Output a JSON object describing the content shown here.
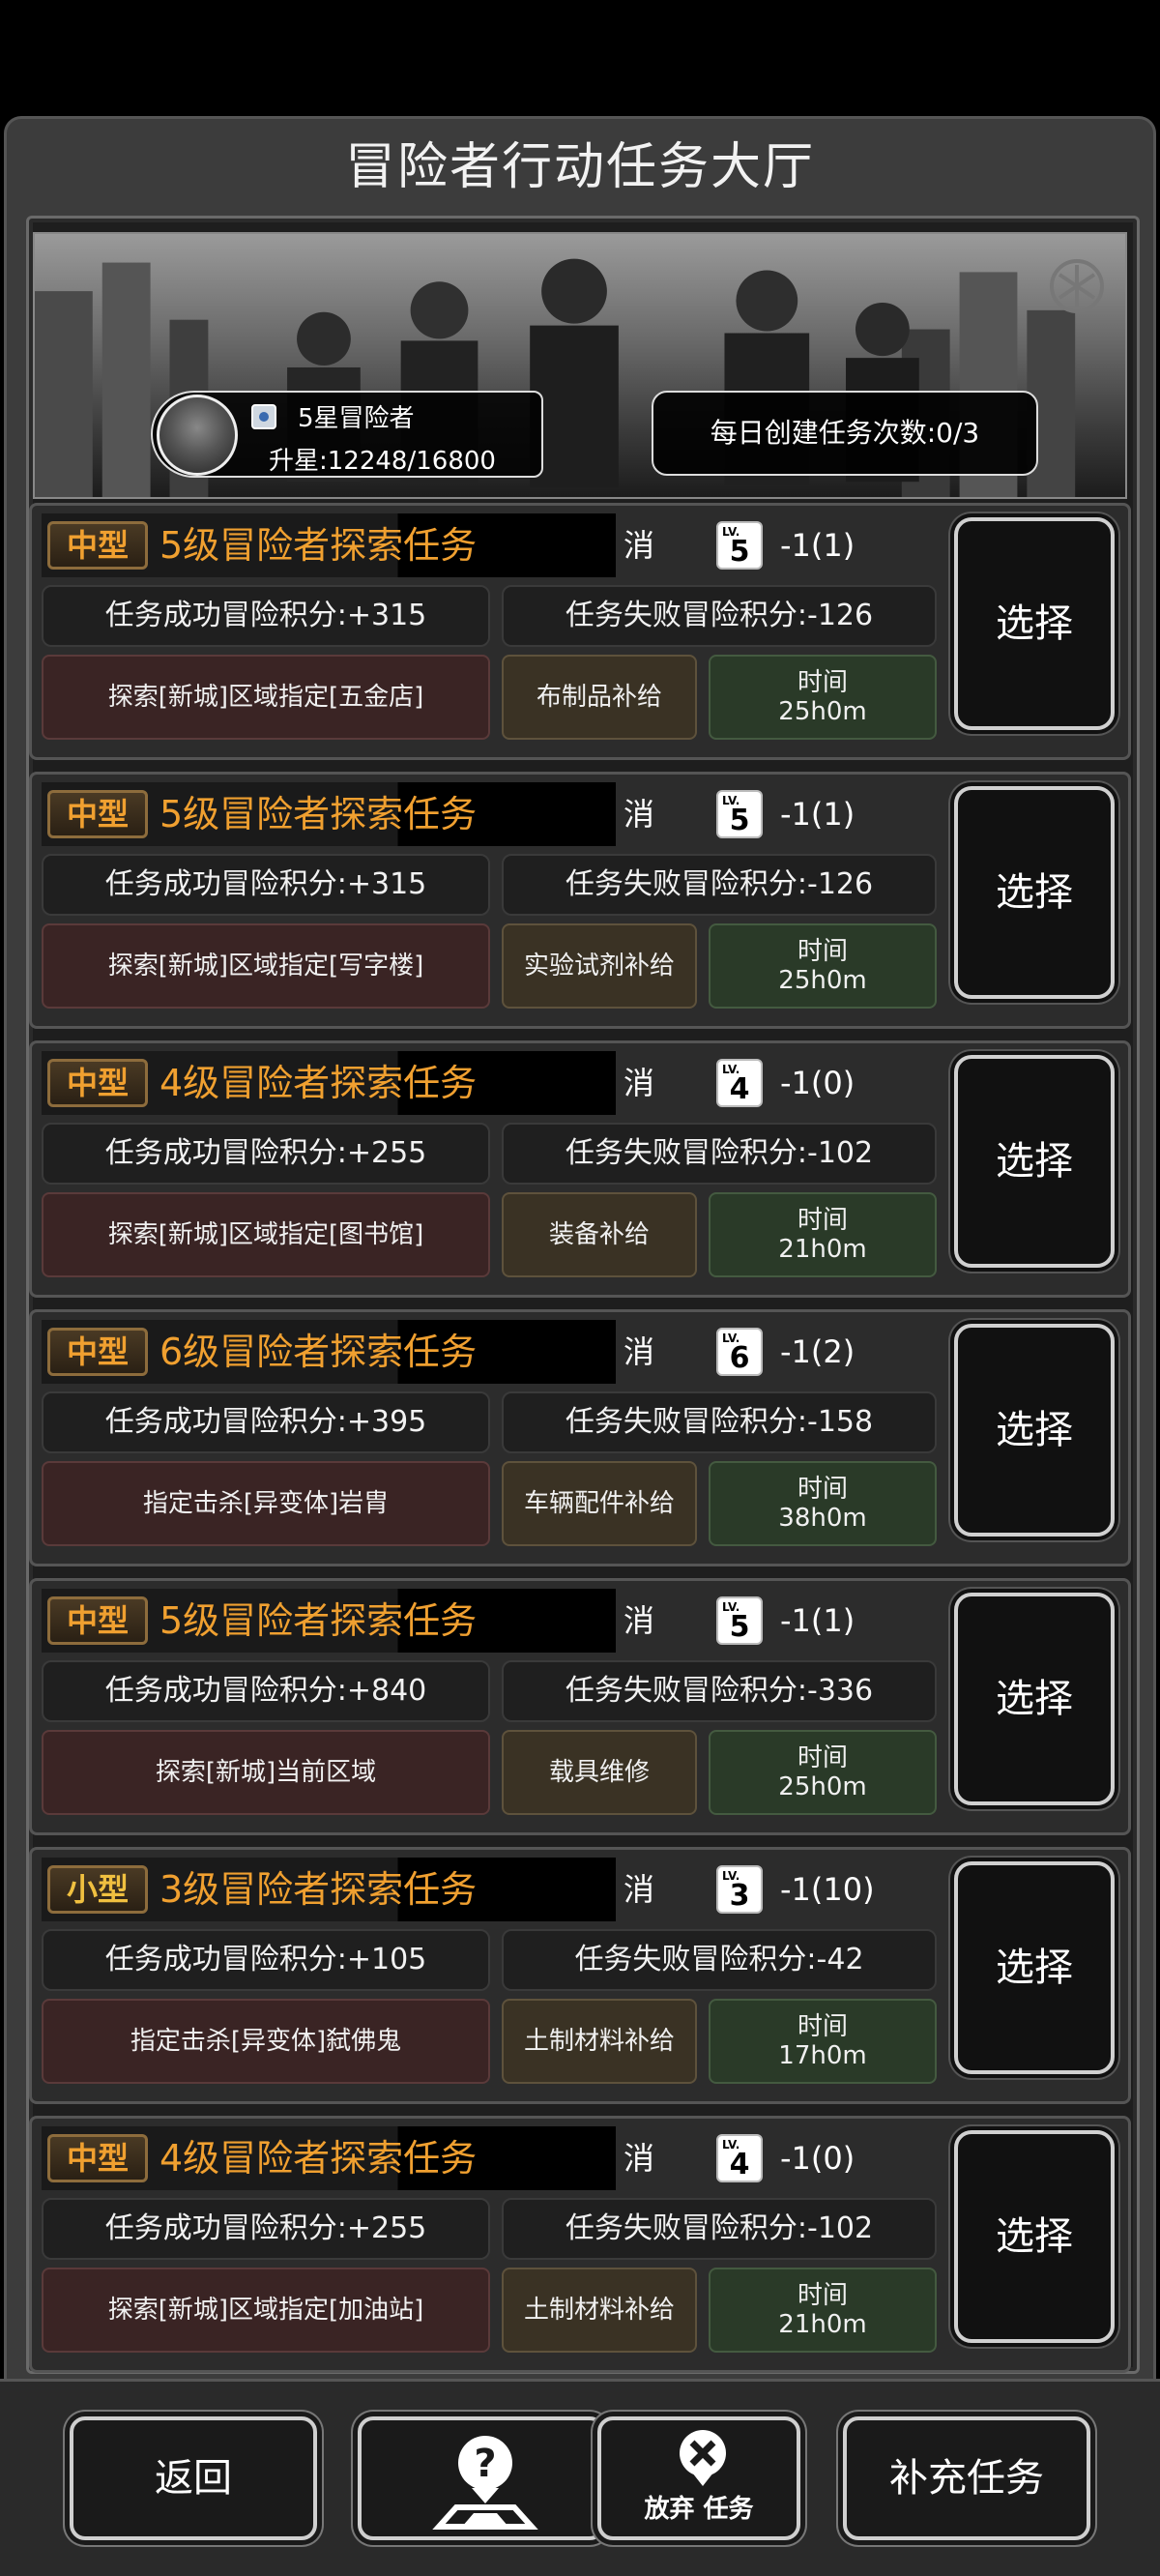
{
  "title": "冒险者行动任务大厅",
  "player": {
    "rank": "5星冒险者",
    "upgrade": "升星:12248/16800"
  },
  "daily": "每日创建任务次数:0/3",
  "cost_label": "消耗:",
  "lv_label": "LV.",
  "select_label": "选择",
  "tasks": [
    {
      "tag": "中型",
      "title": "5级冒险者探索任务",
      "lv": "5",
      "cost": "-1(1)",
      "success": "任务成功冒险积分:+315",
      "fail": "任务失败冒险积分:-126",
      "detail": "探索[新城]区域指定[五金店]",
      "supply": "布制品补给",
      "time_label": "时间",
      "time": "25h0m"
    },
    {
      "tag": "中型",
      "title": "5级冒险者探索任务",
      "lv": "5",
      "cost": "-1(1)",
      "success": "任务成功冒险积分:+315",
      "fail": "任务失败冒险积分:-126",
      "detail": "探索[新城]区域指定[写字楼]",
      "supply": "实验试剂补给",
      "time_label": "时间",
      "time": "25h0m"
    },
    {
      "tag": "中型",
      "title": "4级冒险者探索任务",
      "lv": "4",
      "cost": "-1(0)",
      "success": "任务成功冒险积分:+255",
      "fail": "任务失败冒险积分:-102",
      "detail": "探索[新城]区域指定[图书馆]",
      "supply": "装备补给",
      "time_label": "时间",
      "time": "21h0m"
    },
    {
      "tag": "中型",
      "title": "6级冒险者探索任务",
      "lv": "6",
      "cost": "-1(2)",
      "success": "任务成功冒险积分:+395",
      "fail": "任务失败冒险积分:-158",
      "detail": "指定击杀[异变体]岩胄",
      "supply": "车辆配件补给",
      "time_label": "时间",
      "time": "38h0m"
    },
    {
      "tag": "中型",
      "title": "5级冒险者探索任务",
      "lv": "5",
      "cost": "-1(1)",
      "success": "任务成功冒险积分:+840",
      "fail": "任务失败冒险积分:-336",
      "detail": "探索[新城]当前区域",
      "supply": "载具维修",
      "time_label": "时间",
      "time": "25h0m"
    },
    {
      "tag": "小型",
      "title": "3级冒险者探索任务",
      "lv": "3",
      "cost": "-1(10)",
      "success": "任务成功冒险积分:+105",
      "fail": "任务失败冒险积分:-42",
      "detail": "指定击杀[异变体]弑佛鬼",
      "supply": "土制材料补给",
      "time_label": "时间",
      "time": "17h0m"
    },
    {
      "tag": "中型",
      "title": "4级冒险者探索任务",
      "lv": "4",
      "cost": "-1(0)",
      "success": "任务成功冒险积分:+255",
      "fail": "任务失败冒险积分:-102",
      "detail": "探索[新城]区域指定[加油站]",
      "supply": "土制材料补给",
      "time_label": "时间",
      "time": "21h0m"
    }
  ],
  "bottom": {
    "back": "返回",
    "abandon": "放弃 任务",
    "refill": "补充任务"
  },
  "colors": {
    "tag_orange": "#f0a030",
    "detail_bg": "#3a2424",
    "supply_bg": "#3a3224",
    "time_bg": "#2a3a28"
  }
}
